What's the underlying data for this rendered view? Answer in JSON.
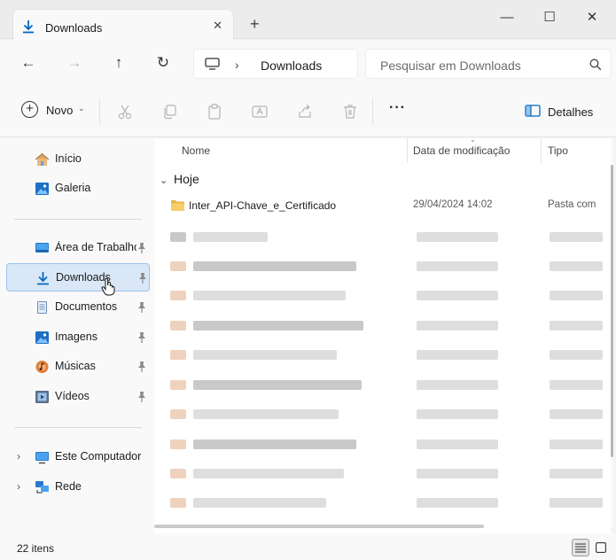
{
  "window": {
    "tab_title": "Downloads",
    "close_tab_glyph": "✕",
    "new_tab_glyph": "+",
    "minimize_glyph": "—",
    "maximize_glyph": "☐",
    "close_glyph": "✕"
  },
  "navigation": {
    "back_glyph": "←",
    "forward_glyph": "→",
    "up_glyph": "↑",
    "refresh_glyph": "↻",
    "breadcrumb_separator": "›",
    "breadcrumb": "Downloads",
    "search_placeholder": "Pesquisar em Downloads"
  },
  "toolbar": {
    "new_label": "Novo",
    "new_chevron": "⌄",
    "more_glyph": "···",
    "details_label": "Detalhes",
    "icons": [
      "cut-icon",
      "copy-icon",
      "paste-icon",
      "rename-icon",
      "share-icon",
      "delete-icon"
    ]
  },
  "sidebar": {
    "expand_glyph": "›",
    "items": [
      {
        "label": "Início",
        "icon": "home-icon",
        "pinned": false,
        "selected": false
      },
      {
        "label": "Galeria",
        "icon": "gallery-icon",
        "pinned": false,
        "selected": false
      },
      {
        "label": "Área de Trabalho",
        "icon": "desktop-icon",
        "pinned": true,
        "selected": false
      },
      {
        "label": "Downloads",
        "icon": "downloads-icon",
        "pinned": true,
        "selected": true
      },
      {
        "label": "Documentos",
        "icon": "documents-icon",
        "pinned": true,
        "selected": false
      },
      {
        "label": "Imagens",
        "icon": "pictures-icon",
        "pinned": true,
        "selected": false
      },
      {
        "label": "Músicas",
        "icon": "music-icon",
        "pinned": true,
        "selected": false
      },
      {
        "label": "Vídeos",
        "icon": "videos-icon",
        "pinned": true,
        "selected": false
      },
      {
        "label": "Este Computador",
        "icon": "this-pc-icon",
        "expandable": true
      },
      {
        "label": "Rede",
        "icon": "network-icon",
        "expandable": true
      }
    ]
  },
  "file_list": {
    "columns": [
      "Nome",
      "Data de modificação",
      "Tipo"
    ],
    "group_chevron": "⌄",
    "group_label": "Hoje",
    "rows": [
      {
        "name": "Inter_API-Chave_e_Certificado",
        "date": "29/04/2024 14:02",
        "type": "Pasta com"
      }
    ],
    "obscured_row_count": 10
  },
  "status": {
    "item_count": "22 itens"
  },
  "colors": {
    "accent": "#0067c0",
    "selection_bg": "#d9e7f7",
    "selection_border": "#99c2ec",
    "folder": "#e9b44c"
  }
}
